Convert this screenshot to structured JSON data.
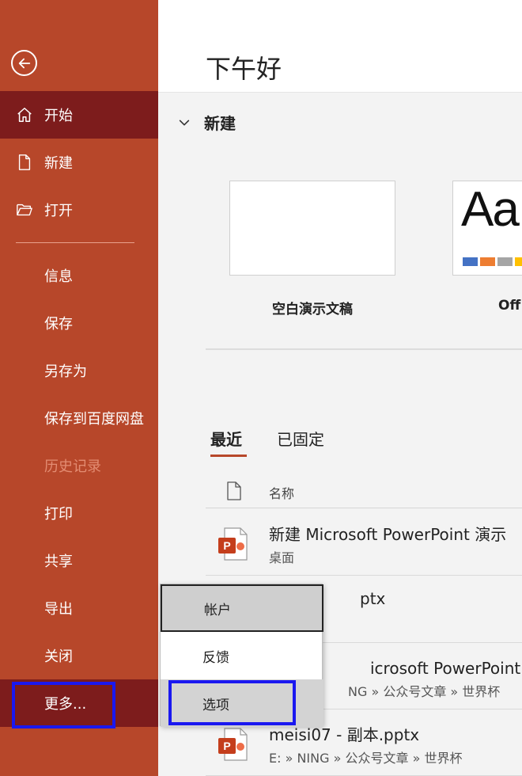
{
  "sidebar": {
    "back_icon": "back-arrow-icon",
    "items": [
      {
        "label": "开始",
        "icon": "home-icon"
      },
      {
        "label": "新建",
        "icon": "new-document-icon"
      },
      {
        "label": "打开",
        "icon": "open-folder-icon"
      },
      {
        "label": "信息"
      },
      {
        "label": "保存"
      },
      {
        "label": "另存为"
      },
      {
        "label": "保存到百度网盘"
      },
      {
        "label": "历史记录"
      },
      {
        "label": "打印"
      },
      {
        "label": "共享"
      },
      {
        "label": "导出"
      },
      {
        "label": "关闭"
      },
      {
        "label": "更多..."
      }
    ]
  },
  "header": {
    "greeting": "下午好"
  },
  "new_section": {
    "title": "新建",
    "templates": [
      {
        "label": "空白演示文稿"
      },
      {
        "label": "Off",
        "preview_text": "Aa"
      }
    ]
  },
  "recent": {
    "tabs": [
      "最近",
      "已固定"
    ],
    "column_name": "名称",
    "files": [
      {
        "name": "新建 Microsoft PowerPoint 演示",
        "path": "桌面"
      },
      {
        "name": "ptx",
        "path": ""
      },
      {
        "name": "icrosoft PowerPoint 演示",
        "path": "NG » 公众号文章 » 世界杯"
      },
      {
        "name": "meisi07 - 副本.pptx",
        "path": "E: » NING » 公众号文章 » 世界杯"
      }
    ]
  },
  "popup": {
    "items": [
      {
        "label": "帐户"
      },
      {
        "label": "反馈"
      },
      {
        "label": "选项"
      }
    ]
  },
  "colors": {
    "sidebar": "#b7472a",
    "sidebar_active": "#7d1c1c",
    "highlight": "#1a18f0",
    "swatches": [
      "#4472c4",
      "#ed7d31",
      "#a5a5a5",
      "#ffc000"
    ]
  }
}
